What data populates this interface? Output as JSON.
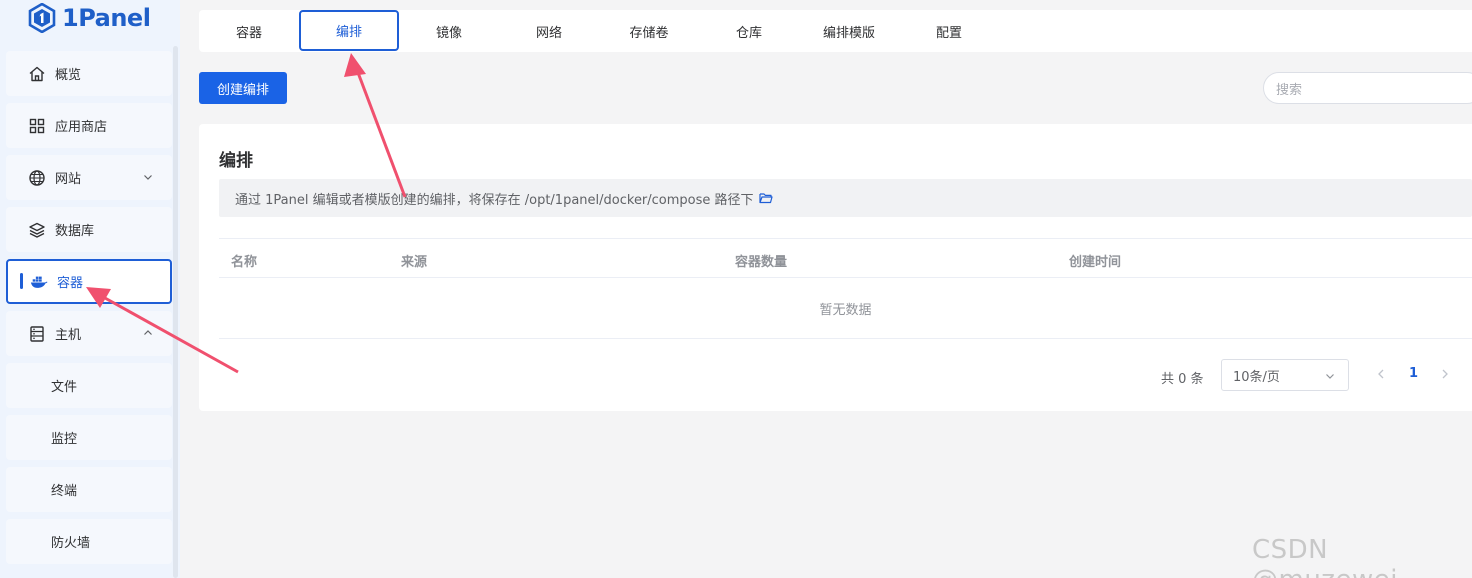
{
  "app": {
    "logo_text": "1Panel"
  },
  "sidebar": {
    "items": [
      {
        "label": "概览",
        "icon": "home-icon"
      },
      {
        "label": "应用商店",
        "icon": "grid-icon"
      },
      {
        "label": "网站",
        "icon": "globe-icon",
        "expand": "chevron-down-icon"
      },
      {
        "label": "数据库",
        "icon": "layers-icon"
      },
      {
        "label": "容器",
        "icon": "docker-icon",
        "active": true
      },
      {
        "label": "主机",
        "icon": "server-icon",
        "expand": "chevron-up-icon"
      }
    ],
    "sub_items": [
      {
        "label": "文件"
      },
      {
        "label": "监控"
      },
      {
        "label": "终端"
      },
      {
        "label": "防火墙"
      }
    ]
  },
  "tabs": [
    {
      "label": "容器"
    },
    {
      "label": "编排",
      "active": true
    },
    {
      "label": "镜像"
    },
    {
      "label": "网络"
    },
    {
      "label": "存储卷"
    },
    {
      "label": "仓库"
    },
    {
      "label": "编排模版"
    },
    {
      "label": "配置"
    }
  ],
  "toolbar": {
    "create_label": "创建编排",
    "search_placeholder": "搜索"
  },
  "card": {
    "title": "编排",
    "info": "通过 1Panel 编辑或者模版创建的编排，将保存在 /opt/1panel/docker/compose 路径下",
    "columns": [
      "名称",
      "来源",
      "容器数量",
      "创建时间"
    ],
    "empty_text": "暂无数据"
  },
  "pagination": {
    "total": "共 0 条",
    "page_size": "10条/页",
    "current_page": "1"
  },
  "watermark": "CSDN @muzewei",
  "colors": {
    "accent": "#1e5ed6",
    "button": "#1a63e6",
    "arrow": "#f0506e"
  }
}
